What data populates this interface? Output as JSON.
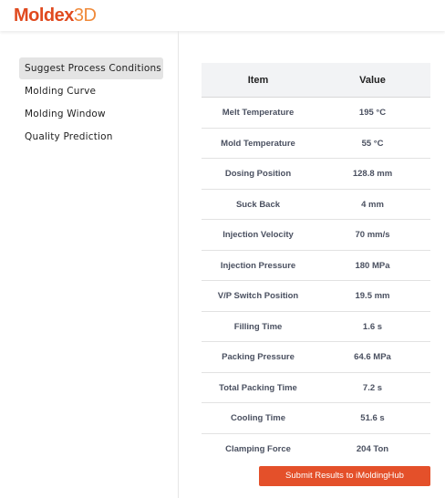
{
  "brand": {
    "logo_part1": "Moldex",
    "logo_part2": "3D"
  },
  "sidebar": {
    "items": [
      {
        "label": "Suggest Process Conditions",
        "active": true
      },
      {
        "label": "Molding Curve",
        "active": false
      },
      {
        "label": "Molding Window",
        "active": false
      },
      {
        "label": "Quality Prediction",
        "active": false
      }
    ]
  },
  "table": {
    "headers": [
      "Item",
      "Value"
    ],
    "rows": [
      {
        "item": "Melt Temperature",
        "value": "195 °C"
      },
      {
        "item": "Mold Temperature",
        "value": "55 °C"
      },
      {
        "item": "Dosing Position",
        "value": "128.8 mm"
      },
      {
        "item": "Suck Back",
        "value": "4 mm"
      },
      {
        "item": "Injection Velocity",
        "value": "70 mm/s"
      },
      {
        "item": "Injection Pressure",
        "value": "180 MPa"
      },
      {
        "item": "V/P Switch Position",
        "value": "19.5 mm"
      },
      {
        "item": "Filling Time",
        "value": "1.6 s"
      },
      {
        "item": "Packing Pressure",
        "value": "64.6 MPa"
      },
      {
        "item": "Total Packing Time",
        "value": "7.2 s"
      },
      {
        "item": "Cooling Time",
        "value": "51.6 s"
      },
      {
        "item": "Clamping Force",
        "value": "204 Ton"
      }
    ]
  },
  "submit_button": {
    "label": "Submit Results to iMoldingHub",
    "color": "#e4502a"
  },
  "colors": {
    "brand_primary": "#e04a1f",
    "brand_secondary": "#f08a3a"
  }
}
